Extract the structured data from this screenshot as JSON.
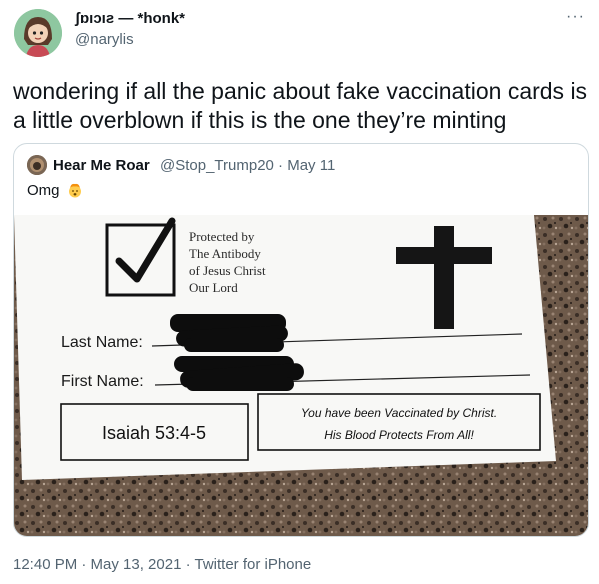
{
  "author": {
    "display_name": "ʃɒıɔıƨ — *honk*",
    "handle": "@narylis"
  },
  "more_icon": "more-icon",
  "tweet": {
    "text": "wondering if all the panic about fake vaccination cards is a little overblown if this is the one they’re minting"
  },
  "quoted_tweet": {
    "display_name": "Hear Me Roar",
    "meta": "@Stop_Trump20 · May 11",
    "text": "Omg",
    "emoji": "exploding-head-emoji"
  },
  "card": {
    "protected_lines": [
      "Protected by",
      "The Antibody",
      "of Jesus Christ",
      "Our Lord"
    ],
    "last_name_label": "Last Name:",
    "first_name_label": "First Name:",
    "verse": "Isaiah 53:4-5",
    "message_line1": "You have been Vaccinated by Christ.",
    "message_line2": "His Blood Protects From All!"
  },
  "footer": {
    "timestamp": "12:40 PM · May 13, 2021 · Twitter for iPhone"
  },
  "colors": {
    "text": "#0f1419",
    "secondary": "#536471",
    "border": "#cfd9de"
  }
}
